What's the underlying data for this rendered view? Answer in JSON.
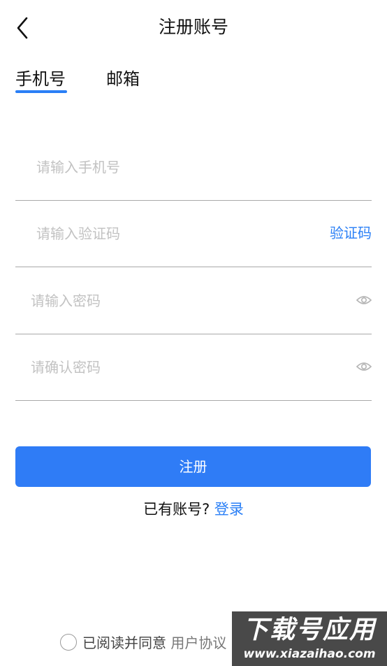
{
  "header": {
    "title": "注册账号"
  },
  "tabs": [
    {
      "label": "手机号",
      "active": true
    },
    {
      "label": "邮箱",
      "active": false
    }
  ],
  "form": {
    "phone_placeholder": "请输入手机号",
    "code_placeholder": "请输入验证码",
    "code_button": "验证码",
    "password_placeholder": "请输入密码",
    "confirm_placeholder": "请确认密码"
  },
  "submit_label": "注册",
  "login": {
    "prompt": "已有账号?",
    "link": "登录"
  },
  "agreement": {
    "text": "已阅读并同意",
    "protocol": "用户协议"
  },
  "watermark": {
    "main": "下载号应用",
    "url": "www.xiazaihao.com"
  },
  "icons": {
    "back": "chevron-left-icon",
    "eye": "eye-icon",
    "check": "radio-circle-icon"
  },
  "colors": {
    "accent": "#2a7ff6",
    "button": "#2f7cf6",
    "divider": "#a9a9a9",
    "placeholder": "#c2c2c2"
  }
}
